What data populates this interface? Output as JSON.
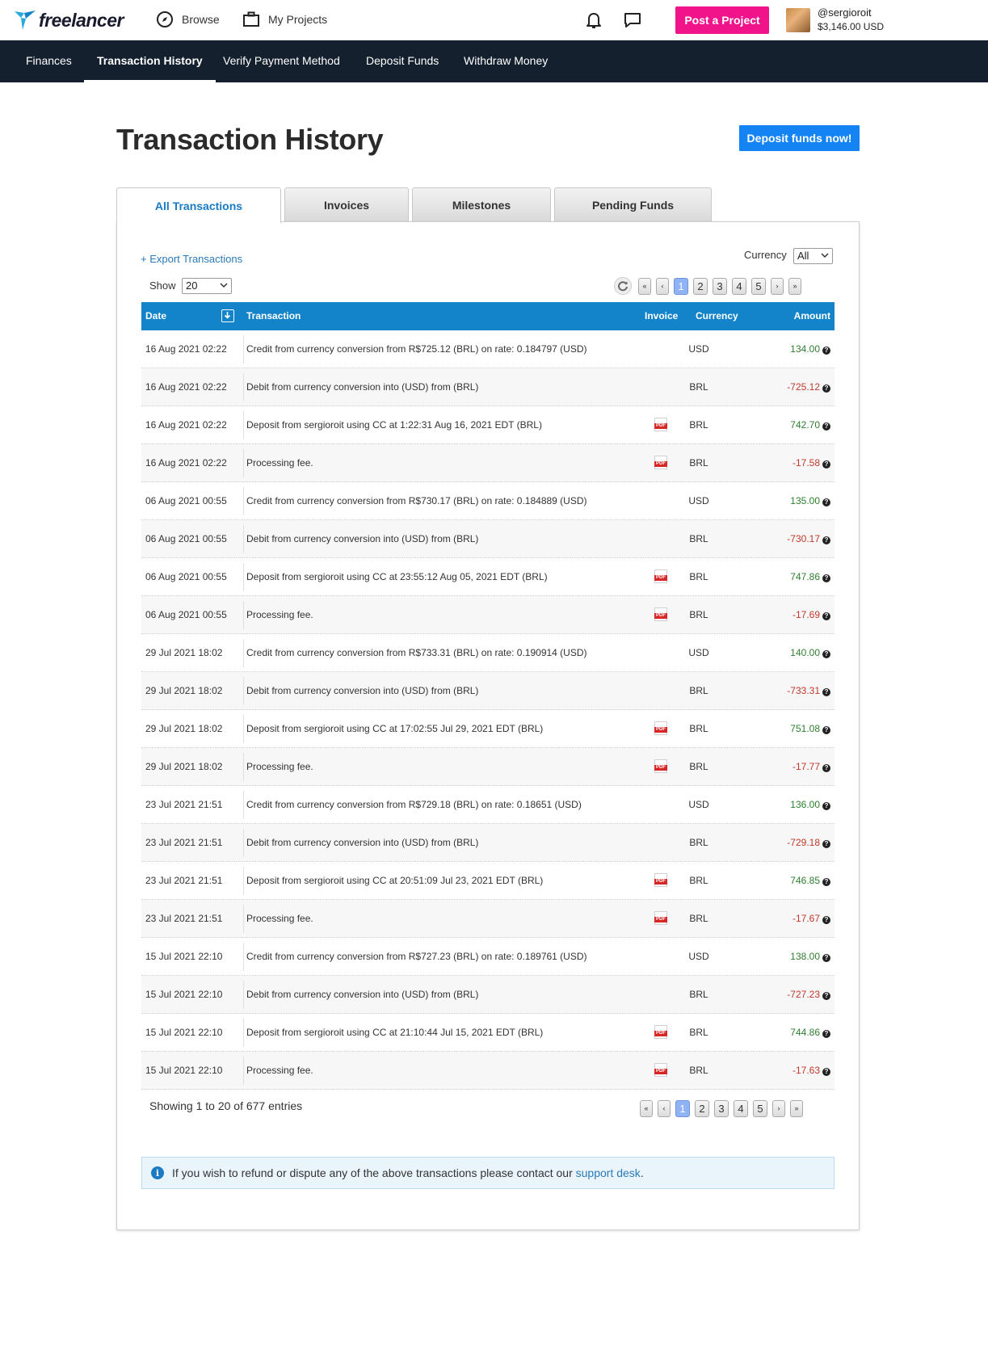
{
  "header": {
    "logo_text": "freelancer",
    "browse_label": "Browse",
    "projects_label": "My Projects",
    "post_project_label": "Post a Project",
    "username": "@sergioroit",
    "balance": "$3,146.00 USD"
  },
  "subnav": {
    "items": [
      "Finances",
      "Transaction History",
      "Verify Payment Method",
      "Deposit Funds",
      "Withdraw Money"
    ],
    "active_index": 1
  },
  "page": {
    "title": "Transaction History",
    "deposit_button": "Deposit funds now!"
  },
  "tabs": [
    "All Transactions",
    "Invoices",
    "Milestones",
    "Pending Funds"
  ],
  "controls": {
    "export_label": "+ Export Transactions",
    "currency_label": "Currency",
    "currency_value": "All",
    "show_label": "Show",
    "show_value": "20",
    "pages": [
      "1",
      "2",
      "3",
      "4",
      "5"
    ],
    "first": "«",
    "prev": "‹",
    "next": "›",
    "last": "»"
  },
  "table": {
    "headers": {
      "date": "Date",
      "transaction": "Transaction",
      "invoice": "Invoice",
      "currency": "Currency",
      "amount": "Amount"
    },
    "rows": [
      {
        "date": "16 Aug 2021 02:22",
        "desc": "Credit from currency conversion from R$725.12 (BRL) on rate: 0.184797 (USD)",
        "invoice": false,
        "currency": "USD",
        "amount": "134.00"
      },
      {
        "date": "16 Aug 2021 02:22",
        "desc": "Debit from currency conversion into (USD) from (BRL)",
        "invoice": false,
        "currency": "BRL",
        "amount": "-725.12"
      },
      {
        "date": "16 Aug 2021 02:22",
        "desc": "Deposit from sergioroit using CC at 1:22:31 Aug 16, 2021 EDT (BRL)",
        "invoice": true,
        "currency": "BRL",
        "amount": "742.70"
      },
      {
        "date": "16 Aug 2021 02:22",
        "desc": "Processing fee.",
        "invoice": true,
        "currency": "BRL",
        "amount": "-17.58"
      },
      {
        "date": "06 Aug 2021 00:55",
        "desc": "Credit from currency conversion from R$730.17 (BRL) on rate: 0.184889 (USD)",
        "invoice": false,
        "currency": "USD",
        "amount": "135.00"
      },
      {
        "date": "06 Aug 2021 00:55",
        "desc": "Debit from currency conversion into (USD) from (BRL)",
        "invoice": false,
        "currency": "BRL",
        "amount": "-730.17"
      },
      {
        "date": "06 Aug 2021 00:55",
        "desc": "Deposit from sergioroit using CC at 23:55:12 Aug 05, 2021 EDT (BRL)",
        "invoice": true,
        "currency": "BRL",
        "amount": "747.86"
      },
      {
        "date": "06 Aug 2021 00:55",
        "desc": "Processing fee.",
        "invoice": true,
        "currency": "BRL",
        "amount": "-17.69"
      },
      {
        "date": "29 Jul 2021 18:02",
        "desc": "Credit from currency conversion from R$733.31 (BRL) on rate: 0.190914 (USD)",
        "invoice": false,
        "currency": "USD",
        "amount": "140.00"
      },
      {
        "date": "29 Jul 2021 18:02",
        "desc": "Debit from currency conversion into (USD) from (BRL)",
        "invoice": false,
        "currency": "BRL",
        "amount": "-733.31"
      },
      {
        "date": "29 Jul 2021 18:02",
        "desc": "Deposit from sergioroit using CC at 17:02:55 Jul 29, 2021 EDT (BRL)",
        "invoice": true,
        "currency": "BRL",
        "amount": "751.08"
      },
      {
        "date": "29 Jul 2021 18:02",
        "desc": "Processing fee.",
        "invoice": true,
        "currency": "BRL",
        "amount": "-17.77"
      },
      {
        "date": "23 Jul 2021 21:51",
        "desc": "Credit from currency conversion from R$729.18 (BRL) on rate: 0.18651 (USD)",
        "invoice": false,
        "currency": "USD",
        "amount": "136.00"
      },
      {
        "date": "23 Jul 2021 21:51",
        "desc": "Debit from currency conversion into (USD) from (BRL)",
        "invoice": false,
        "currency": "BRL",
        "amount": "-729.18"
      },
      {
        "date": "23 Jul 2021 21:51",
        "desc": "Deposit from sergioroit using CC at 20:51:09 Jul 23, 2021 EDT (BRL)",
        "invoice": true,
        "currency": "BRL",
        "amount": "746.85"
      },
      {
        "date": "23 Jul 2021 21:51",
        "desc": "Processing fee.",
        "invoice": true,
        "currency": "BRL",
        "amount": "-17.67"
      },
      {
        "date": "15 Jul 2021 22:10",
        "desc": "Credit from currency conversion from R$727.23 (BRL) on rate: 0.189761 (USD)",
        "invoice": false,
        "currency": "USD",
        "amount": "138.00"
      },
      {
        "date": "15 Jul 2021 22:10",
        "desc": "Debit from currency conversion into (USD) from (BRL)",
        "invoice": false,
        "currency": "BRL",
        "amount": "-727.23"
      },
      {
        "date": "15 Jul 2021 22:10",
        "desc": "Deposit from sergioroit using CC at 21:10:44 Jul 15, 2021 EDT (BRL)",
        "invoice": true,
        "currency": "BRL",
        "amount": "744.86"
      },
      {
        "date": "15 Jul 2021 22:10",
        "desc": "Processing fee.",
        "invoice": true,
        "currency": "BRL",
        "amount": "-17.63"
      }
    ]
  },
  "footer": {
    "showing": "Showing 1 to 20 of 677 entries",
    "notice_text": "If you wish to refund or dispute any of the above transactions please contact our",
    "support_link": "support desk",
    "notice_end": "."
  },
  "icons": {
    "pdf_label": "PDF",
    "help_glyph": "?",
    "info_glyph": "i"
  },
  "colors": {
    "brand_blue": "#1384c9",
    "post_pink": "#f0138a",
    "nav_dark": "#14202e",
    "positive": "#2e7d2e",
    "negative": "#c0392b"
  }
}
